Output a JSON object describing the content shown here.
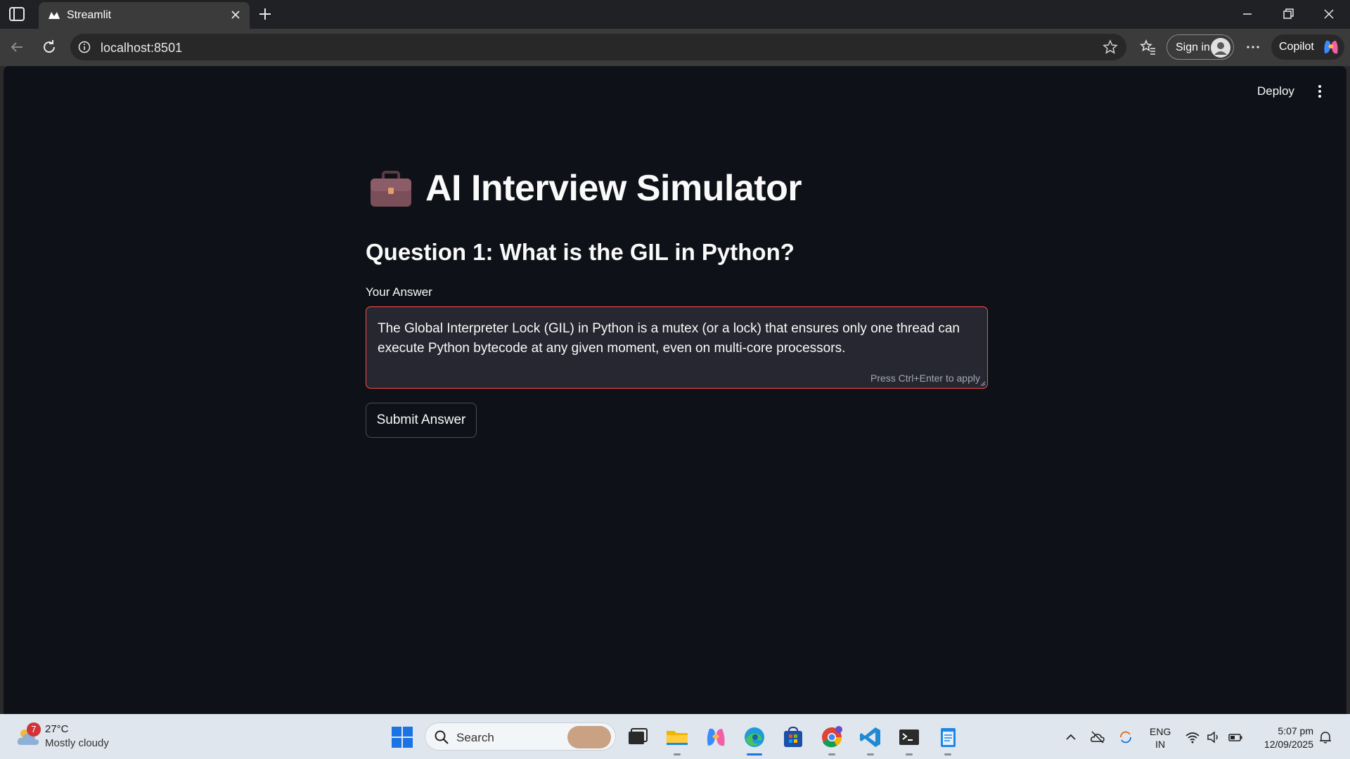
{
  "browser": {
    "tab_title": "Streamlit",
    "url": "localhost:8501",
    "signin_label": "Sign in",
    "copilot_label": "Copilot"
  },
  "app": {
    "deploy_label": "Deploy",
    "title": "AI Interview Simulator",
    "title_icon": "briefcase-icon",
    "question": "Question 1: What is the GIL in Python?",
    "answer_label": "Your Answer",
    "answer_value": "The Global Interpreter Lock (GIL) in Python is a mutex (or a lock) that ensures only one thread can execute Python bytecode at any given moment, even on multi-core processors.",
    "answer_hint": "Press Ctrl+Enter to apply",
    "submit_label": "Submit Answer",
    "accent_color": "#ff4b4b",
    "background_color": "#0e1117"
  },
  "taskbar": {
    "weather_badge": "7",
    "weather_temp": "27°C",
    "weather_desc": "Mostly cloudy",
    "search_label": "Search",
    "lang_line1": "ENG",
    "lang_line2": "IN",
    "time": "5:07 pm",
    "date": "12/09/2025"
  }
}
